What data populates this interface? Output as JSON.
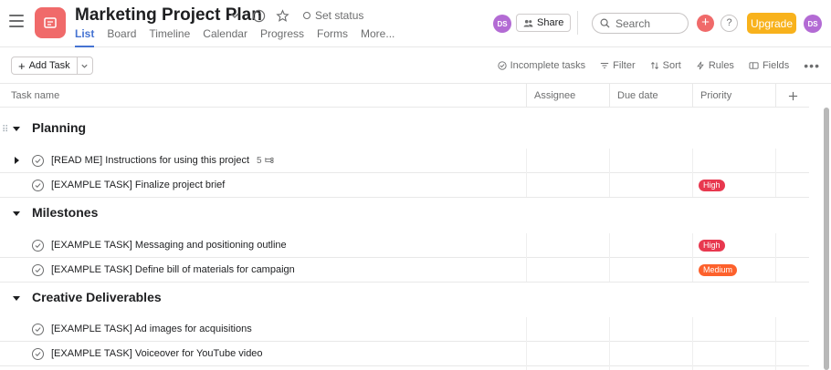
{
  "header": {
    "project_title": "Marketing Project Plan",
    "set_status_label": "Set status",
    "tabs": [
      {
        "label": "List"
      },
      {
        "label": "Board"
      },
      {
        "label": "Timeline"
      },
      {
        "label": "Calendar"
      },
      {
        "label": "Progress"
      },
      {
        "label": "Forms"
      },
      {
        "label": "More..."
      }
    ],
    "active_tab": "List",
    "member_initials": "DS",
    "share_label": "Share",
    "search_placeholder": "Search",
    "upgrade_label": "Upgrade",
    "user_initials": "DS",
    "accent_color": "#4573d2",
    "project_icon_color": "#f06a6a"
  },
  "toolbar": {
    "add_task_label": "Add Task",
    "incomplete_tasks_label": "Incomplete tasks",
    "filter_label": "Filter",
    "sort_label": "Sort",
    "rules_label": "Rules",
    "fields_label": "Fields"
  },
  "table": {
    "columns": [
      "Task name",
      "Assignee",
      "Due date",
      "Priority"
    ]
  },
  "sections": [
    {
      "name": "Planning",
      "tasks": [
        {
          "name": "[READ ME] Instructions for using this project",
          "subtasks": "5",
          "priority": ""
        },
        {
          "name": "[EXAMPLE TASK] Finalize project brief",
          "priority": "High"
        }
      ]
    },
    {
      "name": "Milestones",
      "tasks": [
        {
          "name": "[EXAMPLE TASK] Messaging and positioning outline",
          "priority": "High"
        },
        {
          "name": "[EXAMPLE TASK] Define bill of materials for campaign",
          "priority": "Medium"
        }
      ]
    },
    {
      "name": "Creative Deliverables",
      "tasks": [
        {
          "name": "[EXAMPLE TASK] Ad images for acquisitions",
          "priority": ""
        },
        {
          "name": "[EXAMPLE TASK] Voiceover for YouTube video",
          "priority": ""
        }
      ]
    }
  ],
  "priority_colors": {
    "High": "#e8384f",
    "Medium": "#fd612c"
  }
}
